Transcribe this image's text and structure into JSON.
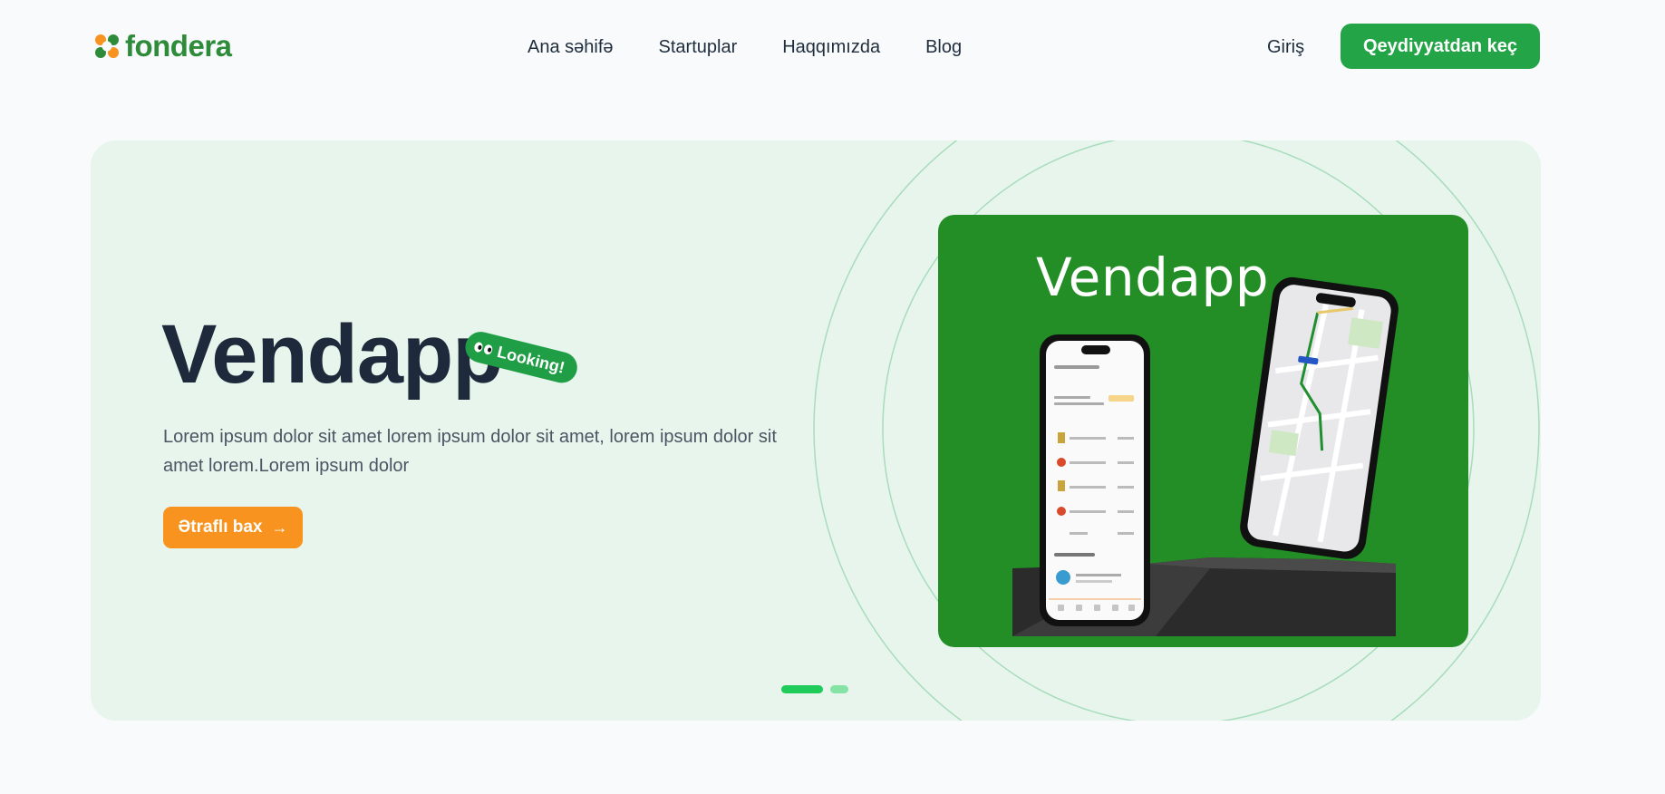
{
  "header": {
    "logo_text": "fondera",
    "nav": [
      {
        "label": "Ana səhifə"
      },
      {
        "label": "Startuplar"
      },
      {
        "label": "Haqqımızda"
      },
      {
        "label": "Blog"
      }
    ],
    "login_label": "Giriş",
    "signup_label": "Qeydiyyatdan keç"
  },
  "hero": {
    "title": "Vendapp",
    "badge": "Looking!",
    "description": "Lorem ipsum dolor sit amet lorem ipsum dolor sit amet, lorem ipsum dolor sit amet lorem.Lorem ipsum dolor",
    "cta_label": "Ətraflı bax",
    "cta_icon": "arrow-right-icon",
    "card_title": "Vendapp",
    "slides_total": 2,
    "active_slide": 1
  },
  "colors": {
    "brand_green": "#22a447",
    "hero_bg": "#e7f5ec",
    "card_green": "#248e26",
    "cta_orange": "#f7931e",
    "pager_active": "#1fcc5a"
  }
}
